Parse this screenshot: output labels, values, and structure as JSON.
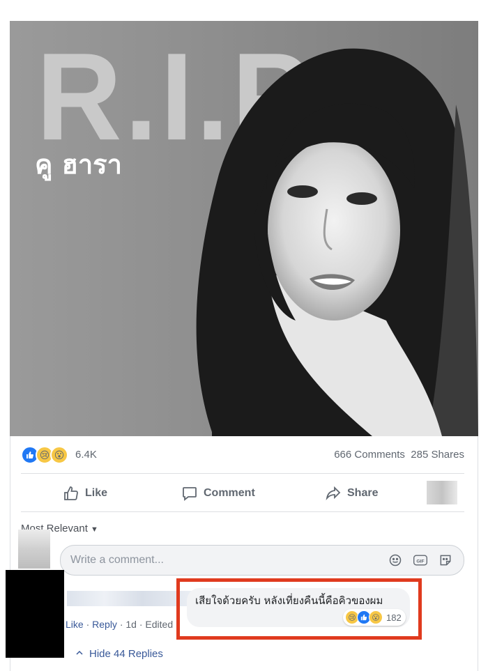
{
  "post": {
    "image_heading": "R.I.P.",
    "image_name": "คู ฮารา"
  },
  "reactions": {
    "icons": [
      "like-icon",
      "sad-icon",
      "wow-icon"
    ],
    "count": "6.4K",
    "comments": "666 Comments",
    "shares": "285 Shares"
  },
  "actions": {
    "like": "Like",
    "comment": "Comment",
    "share": "Share"
  },
  "comments_section": {
    "sort_label": "Most Relevant",
    "input_placeholder": "Write a comment...",
    "input_icons": [
      "emoji-icon",
      "gif-icon",
      "sticker-icon"
    ],
    "comment": {
      "text": "เสียใจด้วยครับ หลังเที่ยงคืนนี้คือคิวของผม",
      "reaction_icons": [
        "sad-icon",
        "haha-icon",
        "wow-icon"
      ],
      "reaction_count": "182",
      "meta_like": "Like",
      "meta_reply": "Reply",
      "meta_time": "1d",
      "meta_edited": "Edited"
    },
    "hide_replies": "Hide 44 Replies"
  },
  "colors": {
    "link": "#385898",
    "like_blue": "#2078f4",
    "highlight": "#e03a1e"
  }
}
